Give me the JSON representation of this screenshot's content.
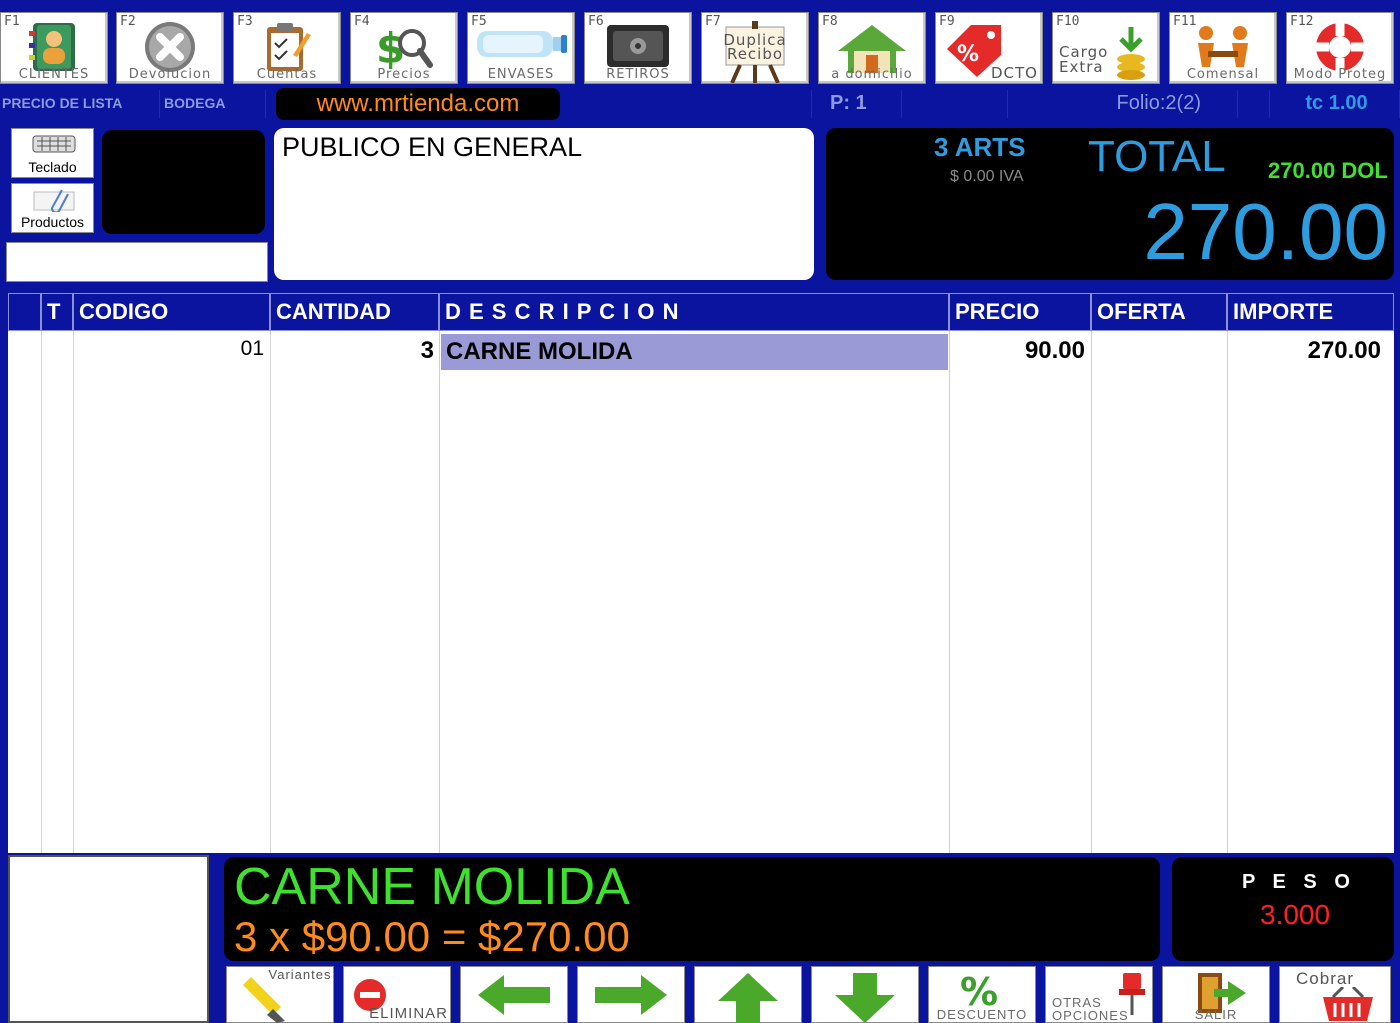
{
  "toolbar": {
    "keys": [
      {
        "key": "F1",
        "label": "CLIENTES",
        "icon": "contacts-book-icon"
      },
      {
        "key": "F2",
        "label": "Devolucion",
        "icon": "cancel-x-icon"
      },
      {
        "key": "F3",
        "label": "Cuentas",
        "icon": "clipboard-pencil-icon"
      },
      {
        "key": "F4",
        "label": "Precios",
        "icon": "dollar-magnifier-icon"
      },
      {
        "key": "F5",
        "label": "ENVASES",
        "icon": "water-bottle-icon"
      },
      {
        "key": "F6",
        "label": "RETIROS",
        "icon": "safe-icon"
      },
      {
        "key": "F7",
        "label": "Duplica Recibo",
        "icon": "easel-sign-icon"
      },
      {
        "key": "F8",
        "label": "a domicilio",
        "icon": "house-icon"
      },
      {
        "key": "F9",
        "label": "DCTO",
        "icon": "discount-tag-icon"
      },
      {
        "key": "F10",
        "label": "Cargo Extra",
        "icon": "coins-arrow-icon"
      },
      {
        "key": "F11",
        "label": "Comensal",
        "icon": "people-table-icon"
      },
      {
        "key": "F12",
        "label": "Modo Proteg",
        "icon": "lifebuoy-icon"
      }
    ]
  },
  "infobar": {
    "price_list": "PRECIO DE LISTA",
    "warehouse": "BODEGA",
    "website": "www.mrtienda.com",
    "page": "P: 1",
    "folio": "Folio:2(2)",
    "exchange_rate": "tc 1.00"
  },
  "side": {
    "keyboard_label": "Teclado",
    "products_label": "Productos",
    "input_value": ""
  },
  "customer": {
    "name": "PUBLICO EN GENERAL"
  },
  "totals": {
    "articles": "3 ARTS",
    "iva": "$ 0.00 IVA",
    "total_label": "TOTAL",
    "dollars": "270.00 DOL",
    "total": "270.00"
  },
  "table": {
    "headers": [
      "T",
      "CODIGO",
      "CANTIDAD",
      "D E S C R I P C I O N",
      "PRECIO",
      "OFERTA",
      "IMPORTE"
    ],
    "rows": [
      {
        "t": "",
        "code": "01",
        "qty": "3",
        "desc": "CARNE MOLIDA",
        "price": "90.00",
        "offer": "",
        "amount": "270.00"
      }
    ]
  },
  "current_item": {
    "name": "CARNE MOLIDA",
    "calc": "3 x $90.00 = $270.00"
  },
  "weight": {
    "label": "P E S O",
    "value": "3.000"
  },
  "bottom_buttons": [
    {
      "label": "Variantes",
      "icon": "highlighter-icon"
    },
    {
      "label": "ELIMINAR",
      "icon": "no-entry-icon"
    },
    {
      "label": "",
      "icon": "arrow-left-icon"
    },
    {
      "label": "",
      "icon": "arrow-right-icon"
    },
    {
      "label": "",
      "icon": "arrow-up-icon"
    },
    {
      "label": "",
      "icon": "arrow-down-icon"
    },
    {
      "label": "DESCUENTO",
      "icon": "percent-icon"
    },
    {
      "label": "OTRAS OPCIONES",
      "icon": "pushpin-icon"
    },
    {
      "label": "SALIR",
      "icon": "exit-door-icon"
    },
    {
      "label": "Cobrar",
      "icon": "shopping-basket-icon"
    }
  ],
  "colors": {
    "background": "#0a149e",
    "accent_blue": "#2e9de0",
    "green": "#3ee22e",
    "orange": "#ff8c1a",
    "red": "#ff2020",
    "selected_row": "#9a9ad6"
  }
}
